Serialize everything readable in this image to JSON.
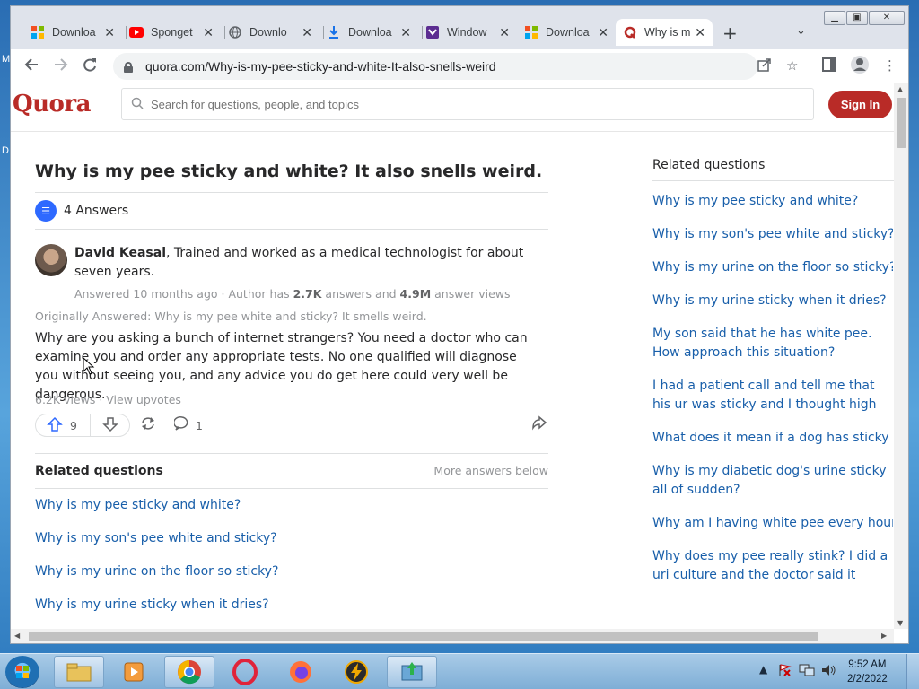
{
  "browser": {
    "tabs": [
      {
        "label": "Downloa",
        "icon": "windows-logo-icon"
      },
      {
        "label": "Sponget",
        "icon": "youtube-icon"
      },
      {
        "label": "Downlo",
        "icon": "globe-icon"
      },
      {
        "label": "Downloa",
        "icon": "download-icon"
      },
      {
        "label": "Window",
        "icon": "app-icon"
      },
      {
        "label": "Downloa",
        "icon": "windows-logo-icon"
      },
      {
        "label": "Why is m",
        "icon": "quora-icon",
        "active": true
      }
    ],
    "url": "quora.com/Why-is-my-pee-sticky-and-white-It-also-snells-weird"
  },
  "quora": {
    "logo": "Quora",
    "search_placeholder": "Search for questions, people, and topics",
    "sign_in": "Sign In",
    "brand_color": "#b92b27",
    "link_color": "#195faa"
  },
  "question": {
    "title": "Why is my pee sticky and white? It also snells weird.",
    "answers_count": "4 Answers"
  },
  "answer": {
    "author_name": "David Keasal",
    "author_credential": ", Trained and worked as a medical technologist for about seven years.",
    "meta_prefix": "Answered 10 months ago · Author has ",
    "meta_answers": "2.7K",
    "meta_mid": " answers and ",
    "meta_views": "4.9M",
    "meta_suffix": " answer views",
    "originally_answered": "Originally Answered: Why is my pee white and sticky? It smells weird.",
    "text": "Why are you asking a bunch of internet strangers? You need a doctor who can examine you and order any appropriate tests. No one qualified will diagnose you without seeing you, and any advice you do get here could very well be dangerous.",
    "views": "6.2K views · View upvotes",
    "upvotes": "9",
    "comments": "1"
  },
  "related_main": {
    "heading": "Related questions",
    "more": "More answers below",
    "items": [
      "Why is my pee sticky and white?",
      "Why is my son's pee white and sticky?",
      "Why is my urine on the floor so sticky?",
      "Why is my urine sticky when it dries?"
    ]
  },
  "sidebar": {
    "heading": "Related questions",
    "items": [
      "Why is my pee sticky and white?",
      "Why is my son's pee white and sticky?",
      "Why is my urine on the floor so sticky?",
      "Why is my urine sticky when it dries?",
      "My son said that he has white pee. How approach this situation?",
      "I had a patient call and tell me that his ur was sticky and I thought high blood suga",
      "What does it mean if a dog has sticky uri",
      "Why is my diabetic dog's urine sticky all of sudden?",
      "Why am I having white pee every hour?",
      "Why does my pee really stink? I did a uri culture and the doctor said it came nega"
    ]
  },
  "taskbar": {
    "time": "9:52 AM",
    "date": "2/2/2022"
  }
}
